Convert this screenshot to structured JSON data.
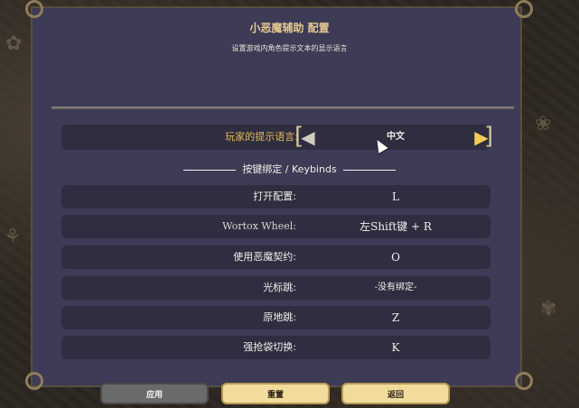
{
  "window": {
    "title": "小恶魔辅助 配置",
    "subtitle": "设置游戏内角色提示文本的显示语言"
  },
  "language_setting": {
    "label": "玩家的提示语言:",
    "value": "中文"
  },
  "keybinds": {
    "section_title": "按键绑定 / Keybinds",
    "rows": [
      {
        "label": "打开配置:",
        "value": "L"
      },
      {
        "label": "Wortox Wheel:",
        "value": "左Shift键 + R"
      },
      {
        "label": "使用恶魔契约:",
        "value": "O"
      },
      {
        "label": "光标跳:",
        "value": "-没有绑定-"
      },
      {
        "label": "原地跳:",
        "value": "Z"
      },
      {
        "label": "强抢袋切换:",
        "value": "K"
      }
    ]
  },
  "buttons": {
    "apply": "应用",
    "reset": "重置",
    "back": "返回"
  },
  "colors": {
    "panel": "#3d3b55",
    "row": "#2f2d40",
    "accent_label": "#e7b957",
    "title": "#e6c891",
    "button_active": "#f1dc9b",
    "button_disabled": "#6a6a6a"
  }
}
